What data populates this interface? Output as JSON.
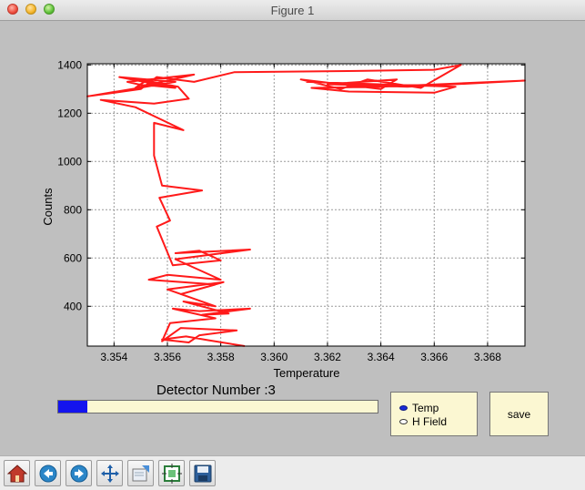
{
  "window": {
    "title": "Figure 1"
  },
  "chart_data": {
    "type": "line",
    "xlabel": "Temperature",
    "ylabel": "Counts",
    "xlim": [
      3.353,
      3.3694
    ],
    "ylim": [
      235,
      1405
    ],
    "xticks": [
      "3.354",
      "3.356",
      "3.358",
      "3.360",
      "3.362",
      "3.364",
      "3.366",
      "3.368"
    ],
    "xtick_values": [
      3.354,
      3.356,
      3.358,
      3.36,
      3.362,
      3.364,
      3.366,
      3.368
    ],
    "yticks": [
      "400",
      "600",
      "800",
      "1000",
      "1200",
      "1400"
    ],
    "ytick_values": [
      400,
      600,
      800,
      1000,
      1200,
      1400
    ],
    "grid": true,
    "series": [
      {
        "color": "#ff1a1a",
        "x": [
          3.3589,
          3.3575,
          3.3567,
          3.3558,
          3.3568,
          3.3572,
          3.3586,
          3.3565,
          3.3558,
          3.3561,
          3.3578,
          3.3562,
          3.3572,
          3.3591,
          3.3573,
          3.3583,
          3.3566,
          3.3578,
          3.356,
          3.3581,
          3.3565,
          3.3578,
          3.3553,
          3.356,
          3.358,
          3.3563,
          3.3591,
          3.3563,
          3.3572,
          3.358,
          3.3562,
          3.3556,
          3.3561,
          3.3557,
          3.3573,
          3.3558,
          3.3555,
          3.3555,
          3.3566,
          3.3548,
          3.3535,
          3.3555,
          3.3568,
          3.3564,
          3.3552,
          3.3548,
          3.357,
          3.3545,
          3.3549,
          3.3563,
          3.3542,
          3.3563,
          3.353,
          3.355,
          3.3556,
          3.357,
          3.3585,
          3.3631,
          3.366,
          3.367,
          3.3655,
          3.3635,
          3.3625,
          3.361,
          3.364,
          3.3646,
          3.362,
          3.365,
          3.3694,
          3.364,
          3.3614,
          3.3628,
          3.366,
          3.3668,
          3.3612
        ],
        "y": [
          235,
          260,
          275,
          262,
          250,
          280,
          300,
          310,
          255,
          330,
          350,
          390,
          380,
          390,
          365,
          370,
          420,
          400,
          470,
          500,
          450,
          490,
          510,
          530,
          510,
          595,
          635,
          620,
          630,
          590,
          570,
          730,
          755,
          850,
          880,
          900,
          1025,
          1160,
          1130,
          1225,
          1255,
          1240,
          1260,
          1310,
          1335,
          1305,
          1360,
          1330,
          1320,
          1305,
          1350,
          1330,
          1270,
          1300,
          1350,
          1330,
          1370,
          1375,
          1380,
          1400,
          1305,
          1340,
          1300,
          1340,
          1300,
          1340,
          1320,
          1310,
          1335,
          1310,
          1305,
          1290,
          1285,
          1310,
          1330
        ]
      }
    ]
  },
  "controls": {
    "detector_label": "Detector Number :3",
    "progress_fraction": 0.09,
    "radio_options": [
      {
        "label": "Temp",
        "selected": true
      },
      {
        "label": "H Field",
        "selected": false
      }
    ],
    "save_label": "save"
  },
  "toolbar": {
    "buttons": [
      "home-icon",
      "back-icon",
      "forward-icon",
      "pan-icon",
      "zoom-icon",
      "configure-icon",
      "save-icon"
    ]
  }
}
